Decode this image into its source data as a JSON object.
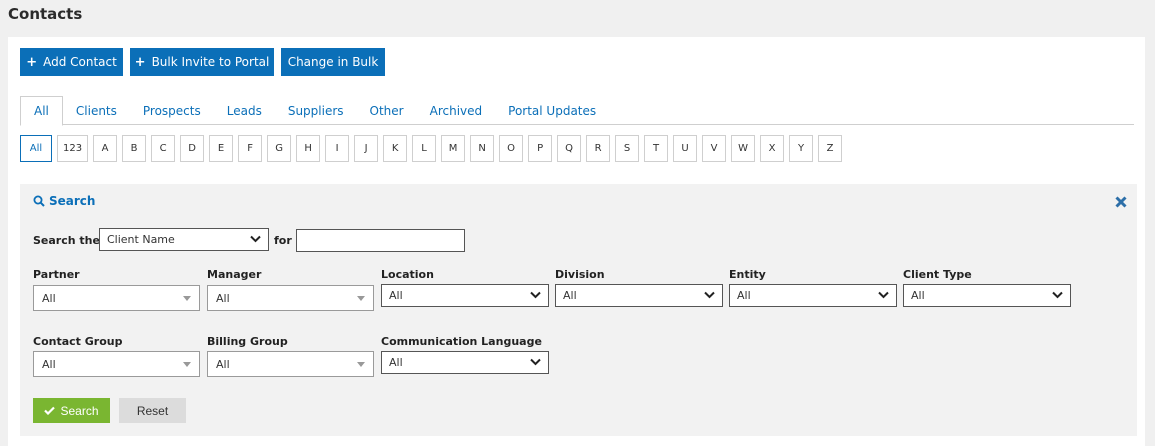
{
  "page": {
    "title": "Contacts"
  },
  "toolbar": {
    "add_contact": "Add Contact",
    "bulk_invite": "Bulk Invite to Portal",
    "change_bulk": "Change in Bulk"
  },
  "tabs": [
    "All",
    "Clients",
    "Prospects",
    "Leads",
    "Suppliers",
    "Other",
    "Archived",
    "Portal Updates"
  ],
  "alphabet": [
    "All",
    "123",
    "A",
    "B",
    "C",
    "D",
    "E",
    "F",
    "G",
    "H",
    "I",
    "J",
    "K",
    "L",
    "M",
    "N",
    "O",
    "P",
    "Q",
    "R",
    "S",
    "T",
    "U",
    "V",
    "W",
    "X",
    "Y",
    "Z"
  ],
  "search": {
    "title": "Search",
    "search_the_label": "Search the",
    "search_field_value": "Client Name",
    "for_label": "for",
    "for_value": "",
    "filters": {
      "partner": {
        "label": "Partner",
        "value": "All"
      },
      "manager": {
        "label": "Manager",
        "value": "All"
      },
      "location": {
        "label": "Location",
        "value": "All"
      },
      "division": {
        "label": "Division",
        "value": "All"
      },
      "entity": {
        "label": "Entity",
        "value": "All"
      },
      "client_type": {
        "label": "Client Type",
        "value": "All"
      },
      "contact_group": {
        "label": "Contact Group",
        "value": "All"
      },
      "billing_group": {
        "label": "Billing Group",
        "value": "All"
      },
      "communication_language": {
        "label": "Communication Language",
        "value": "All"
      }
    },
    "search_button": "Search",
    "reset_button": "Reset"
  },
  "colors": {
    "primary": "#0b6fb8",
    "success": "#7ab631",
    "background": "#f0f0f0"
  },
  "icons": {
    "plus": "plus-icon",
    "search": "magnifier-icon",
    "close": "close-icon",
    "check": "check-icon",
    "caret": "chevron-down-icon"
  }
}
